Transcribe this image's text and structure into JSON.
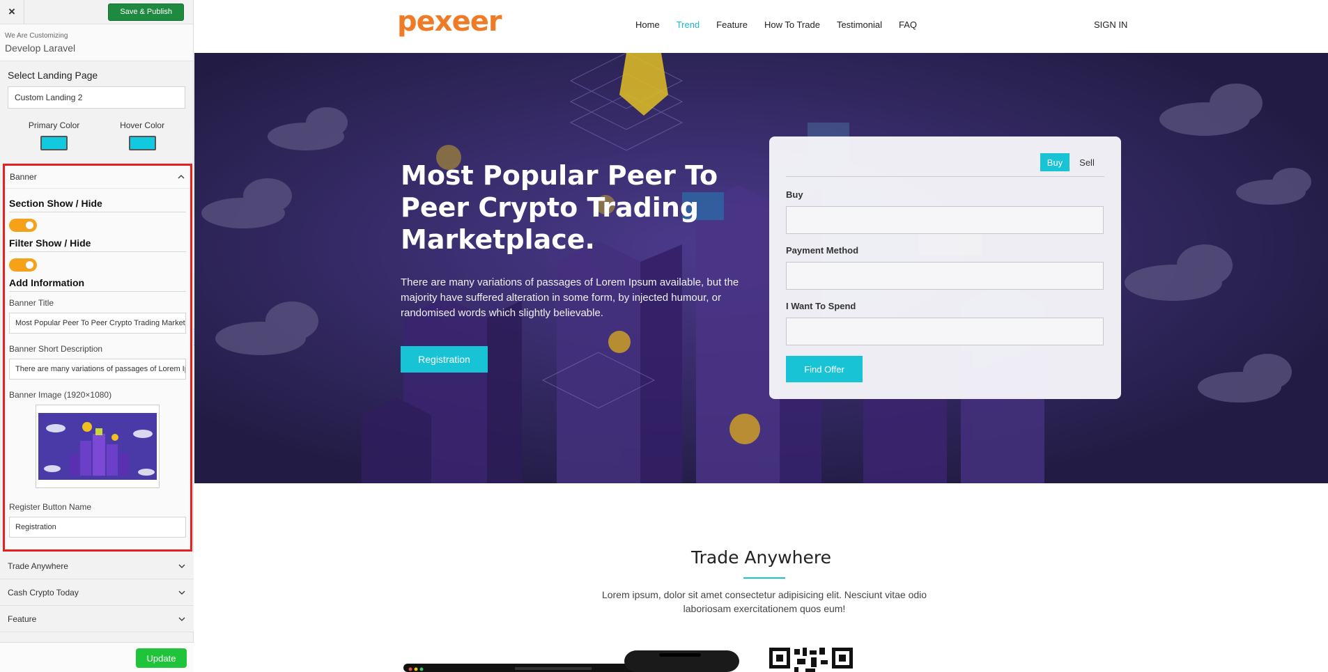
{
  "sidebar": {
    "close_label": "×",
    "publish_label": "Save & Publish",
    "customizing_small": "We Are Customizing",
    "customizing_name": "Develop Laravel",
    "select_page_title": "Select Landing Page",
    "select_page_value": "Custom Landing 2",
    "primary_color_label": "Primary Color",
    "hover_color_label": "Hover Color",
    "primary_color": "#12c9e0",
    "hover_color": "#12c9e0",
    "banner_section": {
      "header": "Banner",
      "section_show_hide": "Section Show / Hide",
      "filter_show_hide": "Filter Show / Hide",
      "add_information": "Add Information",
      "banner_title_label": "Banner Title",
      "banner_title_value": "Most Popular Peer To Peer Crypto Trading Marketplace.",
      "banner_desc_label": "Banner Short Description",
      "banner_desc_value": "There are many variations of passages of Lorem Ipsum available",
      "banner_image_label": "Banner Image (1920×1080)",
      "register_label": "Register Button Name",
      "register_value": "Registration"
    },
    "accordion": [
      "Trade Anywhere",
      "Cash Crypto Today",
      "Feature"
    ],
    "update_label": "Update"
  },
  "preview": {
    "logo": "pexeer",
    "menu": [
      "Home",
      "Trend",
      "Feature",
      "How To Trade",
      "Testimonial",
      "FAQ"
    ],
    "active_menu": "Trend",
    "signin": "SIGN IN",
    "hero": {
      "title": "Most Popular Peer To Peer Crypto Trading Marketplace.",
      "description": "There are many variations of passages of Lorem Ipsum available, but the majority have suffered alteration in some form, by injected humour, or randomised words which slightly believable.",
      "button": "Registration"
    },
    "card": {
      "tab_buy": "Buy",
      "tab_sell": "Sell",
      "field1_label": "Buy",
      "field2_label": "Payment Method",
      "field3_label": "I Want To Spend",
      "button": "Find Offer"
    },
    "trade": {
      "title": "Trade Anywhere",
      "description": "Lorem ipsum, dolor sit amet consectetur adipisicing elit. Nesciunt vitae odio laboriosam exercitationem quos eum!"
    }
  }
}
